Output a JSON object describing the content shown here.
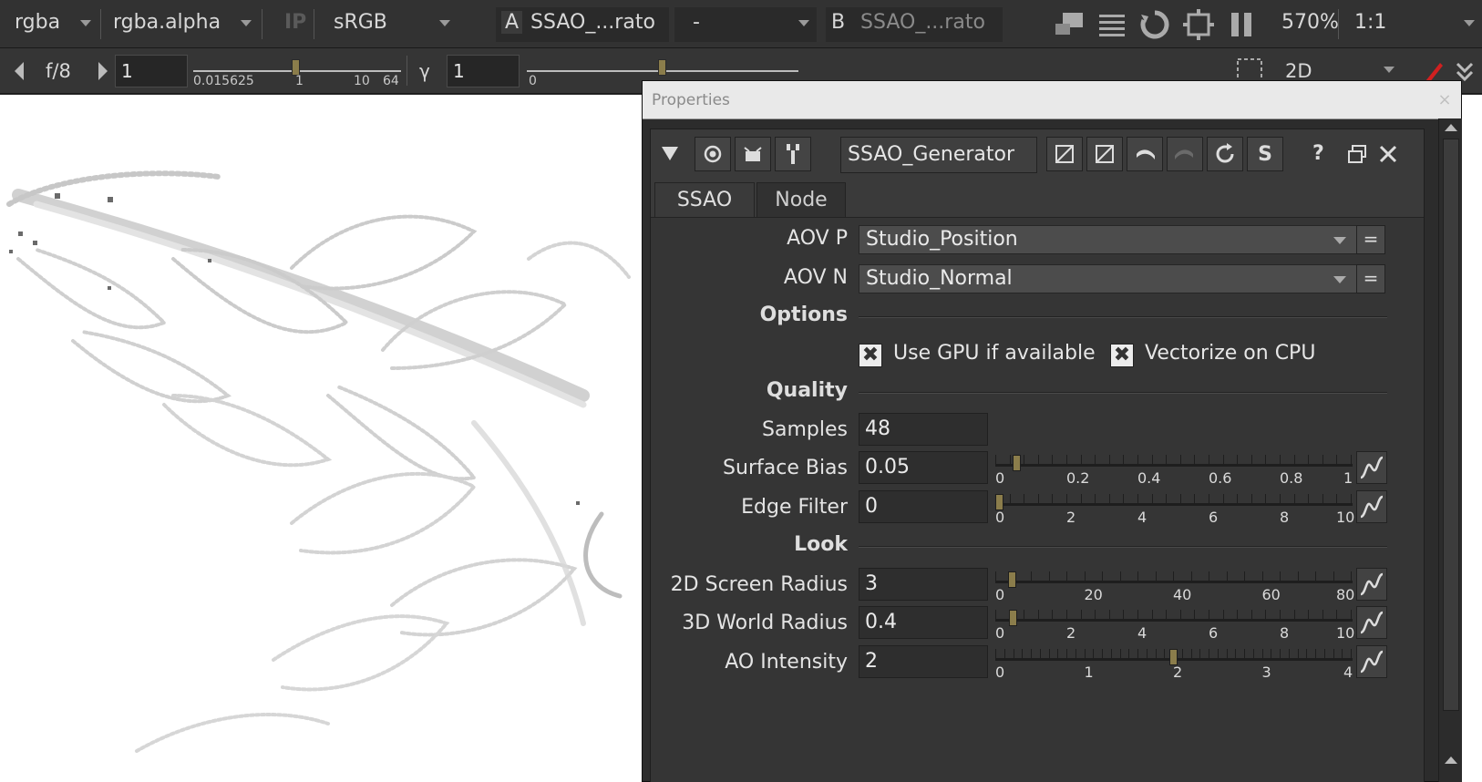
{
  "viewer_toolbar": {
    "channels": "rgba",
    "alpha_channel": "rgba.alpha",
    "ip_label": "IP",
    "colorspace": "sRGB",
    "input_a_label": "A",
    "input_a_value": "SSAO_...rato",
    "compare_mode": "-",
    "input_b_label": "B",
    "input_b_value": "SSAO_...rato",
    "zoom": "570%",
    "ratio": "1:1"
  },
  "viewer_toolbar2": {
    "fstop": "f/8",
    "gain_value": "1",
    "gain_ticks": [
      "0.015625",
      "1",
      "10",
      "64"
    ],
    "gamma_label": "γ",
    "gamma_value": "1",
    "gamma_tick": "0",
    "view_mode": "2D"
  },
  "properties": {
    "title": "Properties",
    "close_glyph": "×",
    "node_name": "SSAO_Generator",
    "tabs": [
      "SSAO",
      "Node"
    ],
    "aov_p_label": "AOV P",
    "aov_p_value": "Studio_Position",
    "aov_n_label": "AOV N",
    "aov_n_value": "Studio_Normal",
    "eq_glyph": "=",
    "options_section": "Options",
    "use_gpu_label": "Use GPU if available",
    "use_gpu_checked": true,
    "vectorize_label": "Vectorize on CPU",
    "vectorize_checked": true,
    "quality_section": "Quality",
    "samples_label": "Samples",
    "samples_value": "48",
    "surface_bias_label": "Surface Bias",
    "surface_bias_value": "0.05",
    "surface_bias_ticks": [
      "0",
      "0.2",
      "0.4",
      "0.6",
      "0.8",
      "1"
    ],
    "edge_filter_label": "Edge Filter",
    "edge_filter_value": "0",
    "edge_filter_ticks": [
      "0",
      "2",
      "4",
      "6",
      "8",
      "10"
    ],
    "look_section": "Look",
    "screen_radius_label": "2D Screen Radius",
    "screen_radius_value": "3",
    "screen_radius_ticks": [
      "0",
      "20",
      "40",
      "60",
      "80"
    ],
    "world_radius_label": "3D World Radius",
    "world_radius_value": "0.4",
    "world_radius_ticks": [
      "0",
      "2",
      "4",
      "6",
      "8",
      "10"
    ],
    "ao_intensity_label": "AO Intensity",
    "ao_intensity_value": "2",
    "ao_intensity_ticks": [
      "0",
      "1",
      "2",
      "3",
      "4"
    ],
    "check_glyph": "✖",
    "help_glyph": "?"
  },
  "colors": {
    "slider_knob": "#8b7d4b",
    "panel_bg": "#353535",
    "accent_red": "#d02020"
  }
}
